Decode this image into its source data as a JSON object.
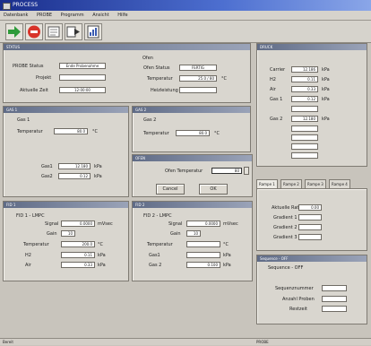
{
  "window": {
    "title": "PROCESS"
  },
  "menu": [
    "Datenbank",
    "PROBE",
    "Programm",
    "Ansicht",
    "Hilfe"
  ],
  "toolbar": {
    "icons": [
      "arrow-right-icon",
      "stop-circle-icon",
      "document-icon",
      "disk-export-icon",
      "chart-document-icon"
    ],
    "colors": {
      "green": "#2e9a3a",
      "red": "#d8342a"
    }
  },
  "status_panel": {
    "header": "STATUS",
    "probe_status_label": "PROBE Status",
    "probe_status_value": "Ende Probenahme",
    "projekt_label": "Projekt",
    "projekt_value": "",
    "aktuelle_zeit_label": "Aktuelle Zeit",
    "aktuelle_zeit_value": "12:00:00",
    "oven": {
      "title": "Ofen",
      "status_label": "Ofen Status",
      "status_value": "FERTIG",
      "temp_label": "Temperatur",
      "temp_value": "25.0 / 80",
      "temp_unit": "°C",
      "heizleistung_label": "Heizleistung",
      "heizleistung_value": ""
    }
  },
  "gas1_panel": {
    "header": "GAS 1",
    "title": "Gas 1",
    "temp_label": "Temperatur",
    "temp_value": "80.0",
    "temp_unit": "°C",
    "gas1_label": "Gas1",
    "gas1_value": "12.180",
    "gas1_unit": "kPa",
    "gas2_label": "Gas2",
    "gas2_value": "0.12",
    "gas2_unit": "kPa"
  },
  "gas2_panel": {
    "header": "GAS 2",
    "title": "Gas 2",
    "temp_label": "Temperatur",
    "temp_value": "80.0",
    "temp_unit": "°C"
  },
  "dialog": {
    "header": "OFEN",
    "label": "Ofen Temperatur",
    "value": "80",
    "cancel_label": "Cancel",
    "ok_label": "OK"
  },
  "fid1_panel": {
    "header": "FID 1",
    "title": "FID 1 - LMPC",
    "signal_label": "Signal",
    "signal_value": "0.0000",
    "signal_unit": "mVsec",
    "gain_label": "Gain",
    "gain_value": "10",
    "temp_label": "Temperatur",
    "temp_value": "200.0",
    "temp_unit": "°C",
    "h2_label": "H2",
    "h2_value": "0.11",
    "h2_unit": "kPa",
    "air_label": "Air",
    "air_value": "0.33",
    "air_unit": "kPa"
  },
  "fid2_panel": {
    "header": "FID 2",
    "title": "FID 2 - LMPC",
    "signal_label": "Signal",
    "signal_value": "0.0000",
    "signal_unit": "mVsec",
    "gain_label": "Gain",
    "gain_value": "10",
    "temp_label": "Temperatur",
    "temp_value": "",
    "temp_unit": "°C",
    "gas1_label": "Gas1",
    "gas1_value": "",
    "gas1_unit": "kPa",
    "gas2_label": "Gas 2",
    "gas2_value": "0.100",
    "gas2_unit": "kPa"
  },
  "right_top_panel": {
    "header": "DRUCK",
    "rows": [
      {
        "label": "Carrier",
        "value": "12.186",
        "unit": "kPa"
      },
      {
        "label": "H2",
        "value": "0.11",
        "unit": "kPa"
      },
      {
        "label": "Air",
        "value": "0.33",
        "unit": "kPa"
      },
      {
        "label": "Gas 1",
        "value": "0.12",
        "unit": "kPa"
      },
      {
        "label": "",
        "value": "",
        "unit": ""
      },
      {
        "label": "Gas 2",
        "value": "12.180",
        "unit": "kPa"
      }
    ]
  },
  "ramp_panel": {
    "tabs": [
      "Rampe 1",
      "Rampe 2",
      "Rampe 3",
      "Rampe 4"
    ],
    "aktuelle_rate_label": "Aktuelle Rate",
    "aktuelle_rate_value": "0.00",
    "gradient1_label": "Gradient 1",
    "gradient2_label": "Gradient 2",
    "gradient3_label": "Gradient 3"
  },
  "sequence_panel": {
    "header": "Sequence - OFF",
    "title": "Sequence - OFF",
    "seq_nummer_label": "Sequenznummer",
    "seq_nummer_value": "",
    "anzahl_proben_label": "Anzahl Proben",
    "anzahl_proben_value": "",
    "restzeit_label": "Restzeit",
    "restzeit_value": ""
  },
  "statusbar": {
    "left": "Bereit",
    "right": "PROBE"
  }
}
